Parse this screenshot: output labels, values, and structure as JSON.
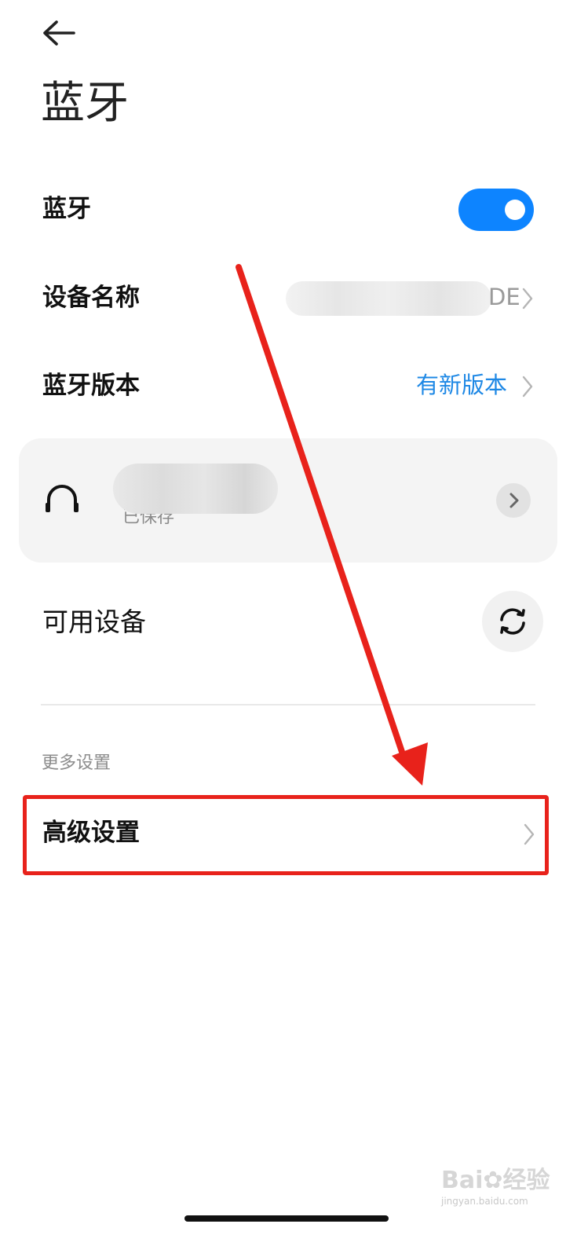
{
  "header": {
    "back_icon": "arrow-left-icon",
    "title": "蓝牙"
  },
  "settings": {
    "bluetooth_label": "蓝牙",
    "bluetooth_enabled": true,
    "device_name_label": "设备名称",
    "device_name_value_visible": "DE",
    "bt_version_label": "蓝牙版本",
    "bt_version_value": "有新版本"
  },
  "paired_device": {
    "icon": "headphones-icon",
    "status": "已保存"
  },
  "available": {
    "label": "可用设备",
    "refresh_icon": "refresh-icon"
  },
  "more": {
    "section_title": "更多设置",
    "advanced_label": "高级设置"
  },
  "watermark": {
    "brand": "Bai",
    "brand2": "经验",
    "url": "jingyan.baidu.com"
  },
  "colors": {
    "accent": "#0d84ff",
    "link": "#1e88e5",
    "annotation": "#e8221b"
  }
}
